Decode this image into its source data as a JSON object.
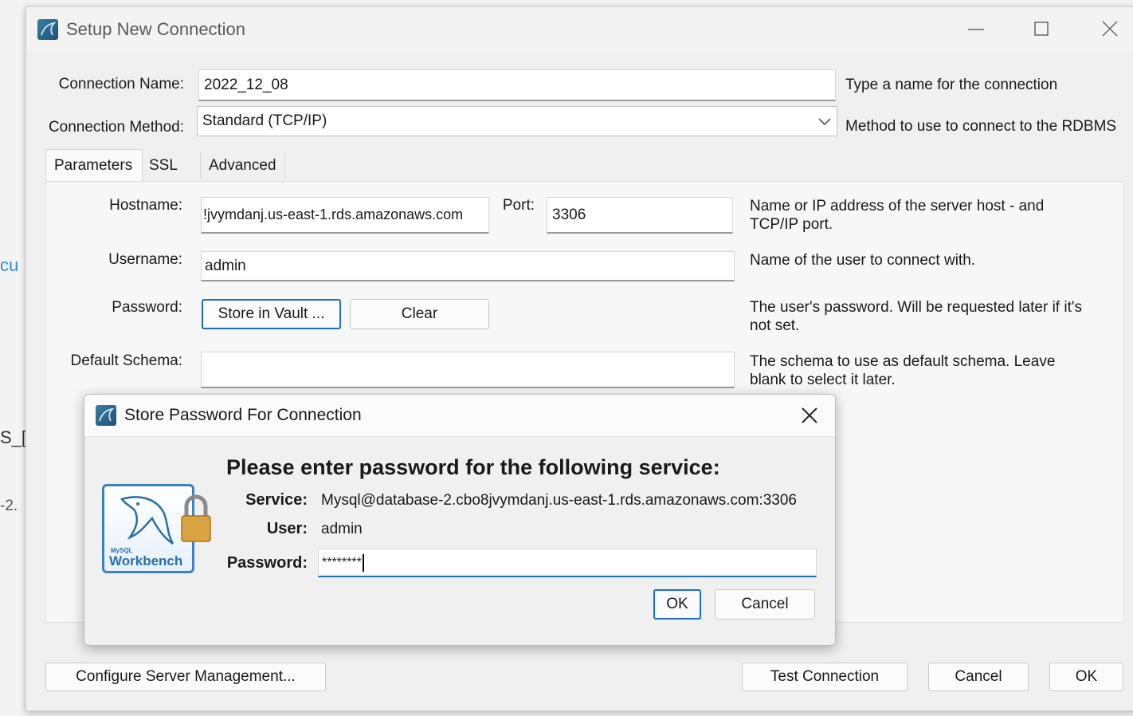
{
  "background": {
    "left_text_1": "cu",
    "left_text_2": "S_[",
    "left_text_3": "-2."
  },
  "window": {
    "title": "Setup New Connection",
    "minimize_glyph": "—",
    "maximize_glyph": "☐",
    "close_glyph": "✕"
  },
  "connection_name": {
    "label": "Connection Name:",
    "value": "2022_12_08",
    "help": "Type a name for the connection"
  },
  "connection_method": {
    "label": "Connection Method:",
    "value": "Standard (TCP/IP)",
    "help": "Method to use to connect to the RDBMS"
  },
  "tabs": [
    {
      "label": "Parameters",
      "active": true
    },
    {
      "label": "SSL",
      "active": false
    },
    {
      "label": "Advanced",
      "active": false
    }
  ],
  "parameters": {
    "hostname_label": "Hostname:",
    "hostname_value": "!jvymdanj.us-east-1.rds.amazonaws.com",
    "port_label": "Port:",
    "port_value": "3306",
    "hostname_help_1": "Name or IP address of the server host - and",
    "hostname_help_2": "TCP/IP port.",
    "username_label": "Username:",
    "username_value": "admin",
    "username_help": "Name of the user to connect with.",
    "password_label": "Password:",
    "store_vault_button": "Store in Vault ...",
    "clear_button": "Clear",
    "password_help_1": "The user's password. Will be requested later if it's",
    "password_help_2": "not set.",
    "schema_label": "Default Schema:",
    "schema_value": "",
    "schema_help_1": "The schema to use as default schema. Leave",
    "schema_help_2": "blank to select it later."
  },
  "footer": {
    "configure_button": "Configure Server Management...",
    "test_button": "Test Connection",
    "cancel_button": "Cancel",
    "ok_button": "OK"
  },
  "dialog": {
    "title": "Store Password For Connection",
    "close_glyph": "✕",
    "heading": "Please enter password for the following service:",
    "service_label": "Service:",
    "service_value": "Mysql@database-2.cbo8jvymdanj.us-east-1.rds.amazonaws.com:3306",
    "user_label": "User:",
    "user_value": "admin",
    "password_label": "Password:",
    "password_value": "********",
    "ok_button": "OK",
    "cancel_button": "Cancel",
    "logo_text": "Workbench",
    "logo_small_text": "MySQL"
  }
}
